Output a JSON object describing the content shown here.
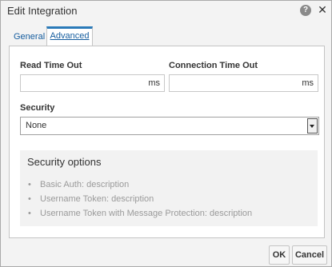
{
  "dialog": {
    "title": "Edit Integration",
    "help_icon": "question-circle-icon",
    "close_icon": "close-x-icon",
    "help_glyph": "?",
    "close_glyph": "✕"
  },
  "tabs": [
    {
      "label": "General",
      "selected": false
    },
    {
      "label": "Advanced",
      "selected": true
    }
  ],
  "advanced": {
    "read_timeout": {
      "label": "Read Time Out",
      "value": "",
      "unit": "ms"
    },
    "connection_timeout": {
      "label": "Connection Time Out",
      "value": "",
      "unit": "ms"
    },
    "security": {
      "label": "Security",
      "selected": "None"
    },
    "security_options": {
      "title": "Security options",
      "items": [
        "Basic Auth: description",
        "Username Token: description",
        "Username Token with Message Protection: description"
      ]
    }
  },
  "buttons": {
    "ok": "OK",
    "cancel": "Cancel"
  },
  "colors": {
    "accent": "#2a7ab8",
    "link": "#145c9e",
    "muted_text": "#9a9a9a"
  }
}
